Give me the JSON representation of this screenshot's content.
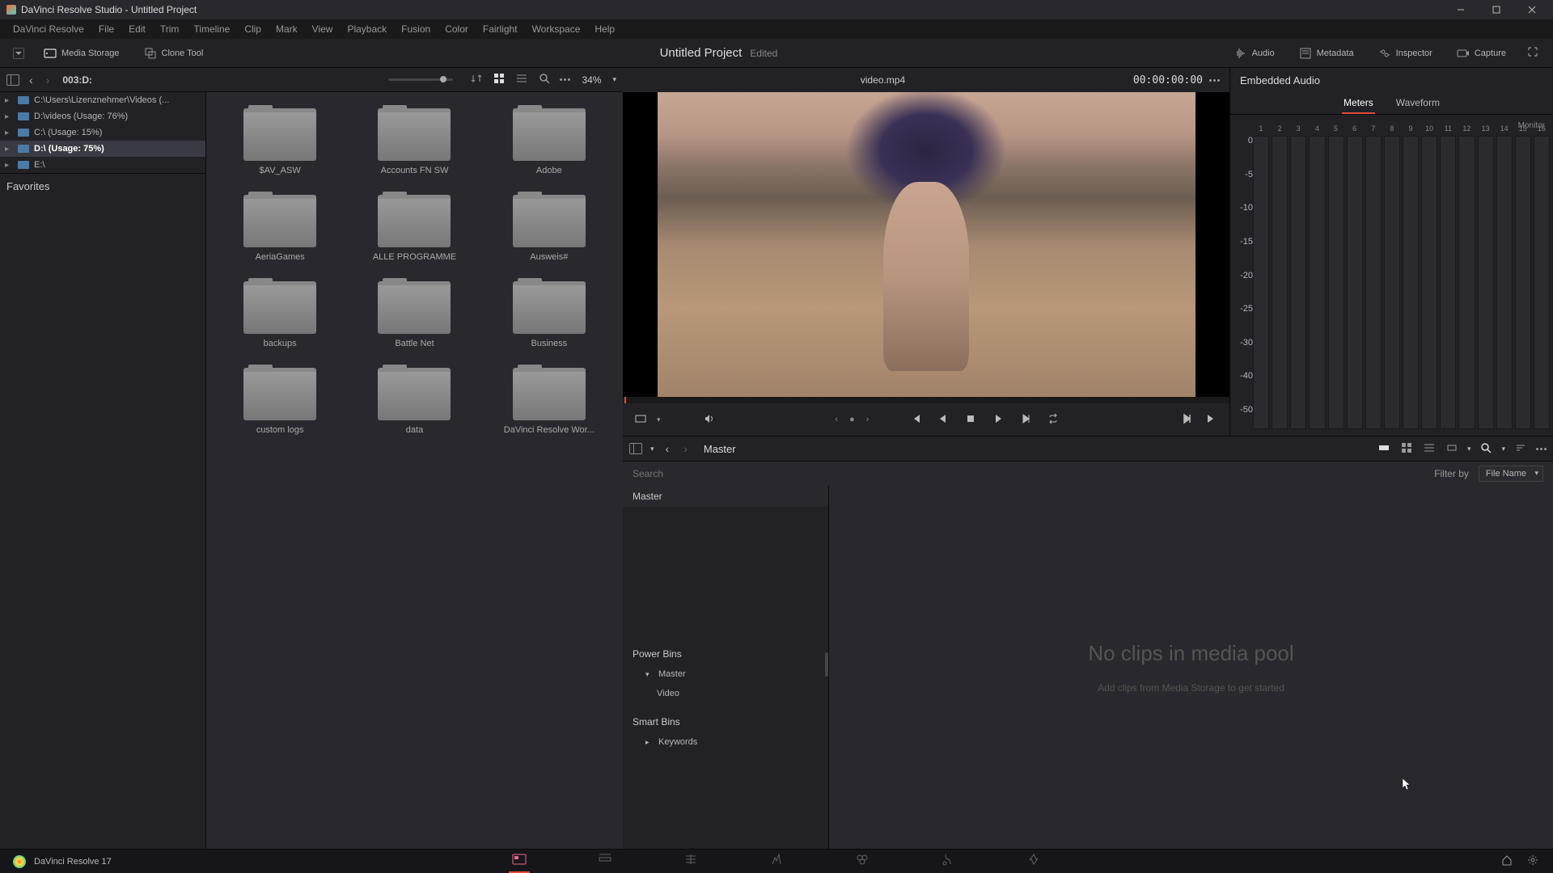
{
  "window": {
    "title": "DaVinci Resolve Studio - Untitled Project"
  },
  "menus": [
    "DaVinci Resolve",
    "File",
    "Edit",
    "Trim",
    "Timeline",
    "Clip",
    "Mark",
    "View",
    "Playback",
    "Fusion",
    "Color",
    "Fairlight",
    "Workspace",
    "Help"
  ],
  "toolbar": {
    "media_storage": "Media Storage",
    "clone_tool": "Clone Tool",
    "project_title": "Untitled Project",
    "project_status": "Edited",
    "audio": "Audio",
    "metadata": "Metadata",
    "inspector": "Inspector",
    "capture": "Capture"
  },
  "browser": {
    "path": "003:D:",
    "zoom": "34%",
    "tree": [
      {
        "label": "C:\\Users\\Lizenznehmer\\Videos (...",
        "selected": false
      },
      {
        "label": "D:\\videos (Usage: 76%)",
        "selected": false
      },
      {
        "label": "C:\\ (Usage: 15%)",
        "selected": false
      },
      {
        "label": "D:\\ (Usage: 75%)",
        "selected": true
      },
      {
        "label": "E:\\",
        "selected": false
      }
    ],
    "favorites_header": "Favorites",
    "folders": [
      "$AV_ASW",
      "Accounts FN SW",
      "Adobe",
      "AeriaGames",
      "ALLE PROGRAMME",
      "Ausweis#",
      "backups",
      "Battle Net",
      "Business",
      "custom logs",
      "data",
      "DaVinci Resolve Wor..."
    ]
  },
  "viewer": {
    "clip_name": "video.mp4",
    "timecode": "00:00:00:00"
  },
  "audio_panel": {
    "title": "Embedded Audio",
    "tab_meters": "Meters",
    "tab_waveform": "Waveform",
    "channels": [
      "1",
      "2",
      "3",
      "4",
      "5",
      "6",
      "7",
      "8",
      "9",
      "10",
      "11",
      "12",
      "13",
      "14",
      "15",
      "16"
    ],
    "monitor": "Monitor",
    "scale": [
      "0",
      "-5",
      "-10",
      "-15",
      "-20",
      "-25",
      "-30",
      "-40",
      "-50"
    ]
  },
  "pool": {
    "master": "Master",
    "search_placeholder": "Search",
    "filter_label": "Filter by",
    "filter_value": "File Name",
    "tree_master": "Master",
    "power_bins": "Power Bins",
    "pb_master": "Master",
    "pb_video": "Video",
    "smart_bins": "Smart Bins",
    "keywords": "Keywords",
    "empty_title": "No clips in media pool",
    "empty_sub": "Add clips from Media Storage to get started"
  },
  "footer": {
    "version": "DaVinci Resolve 17"
  }
}
